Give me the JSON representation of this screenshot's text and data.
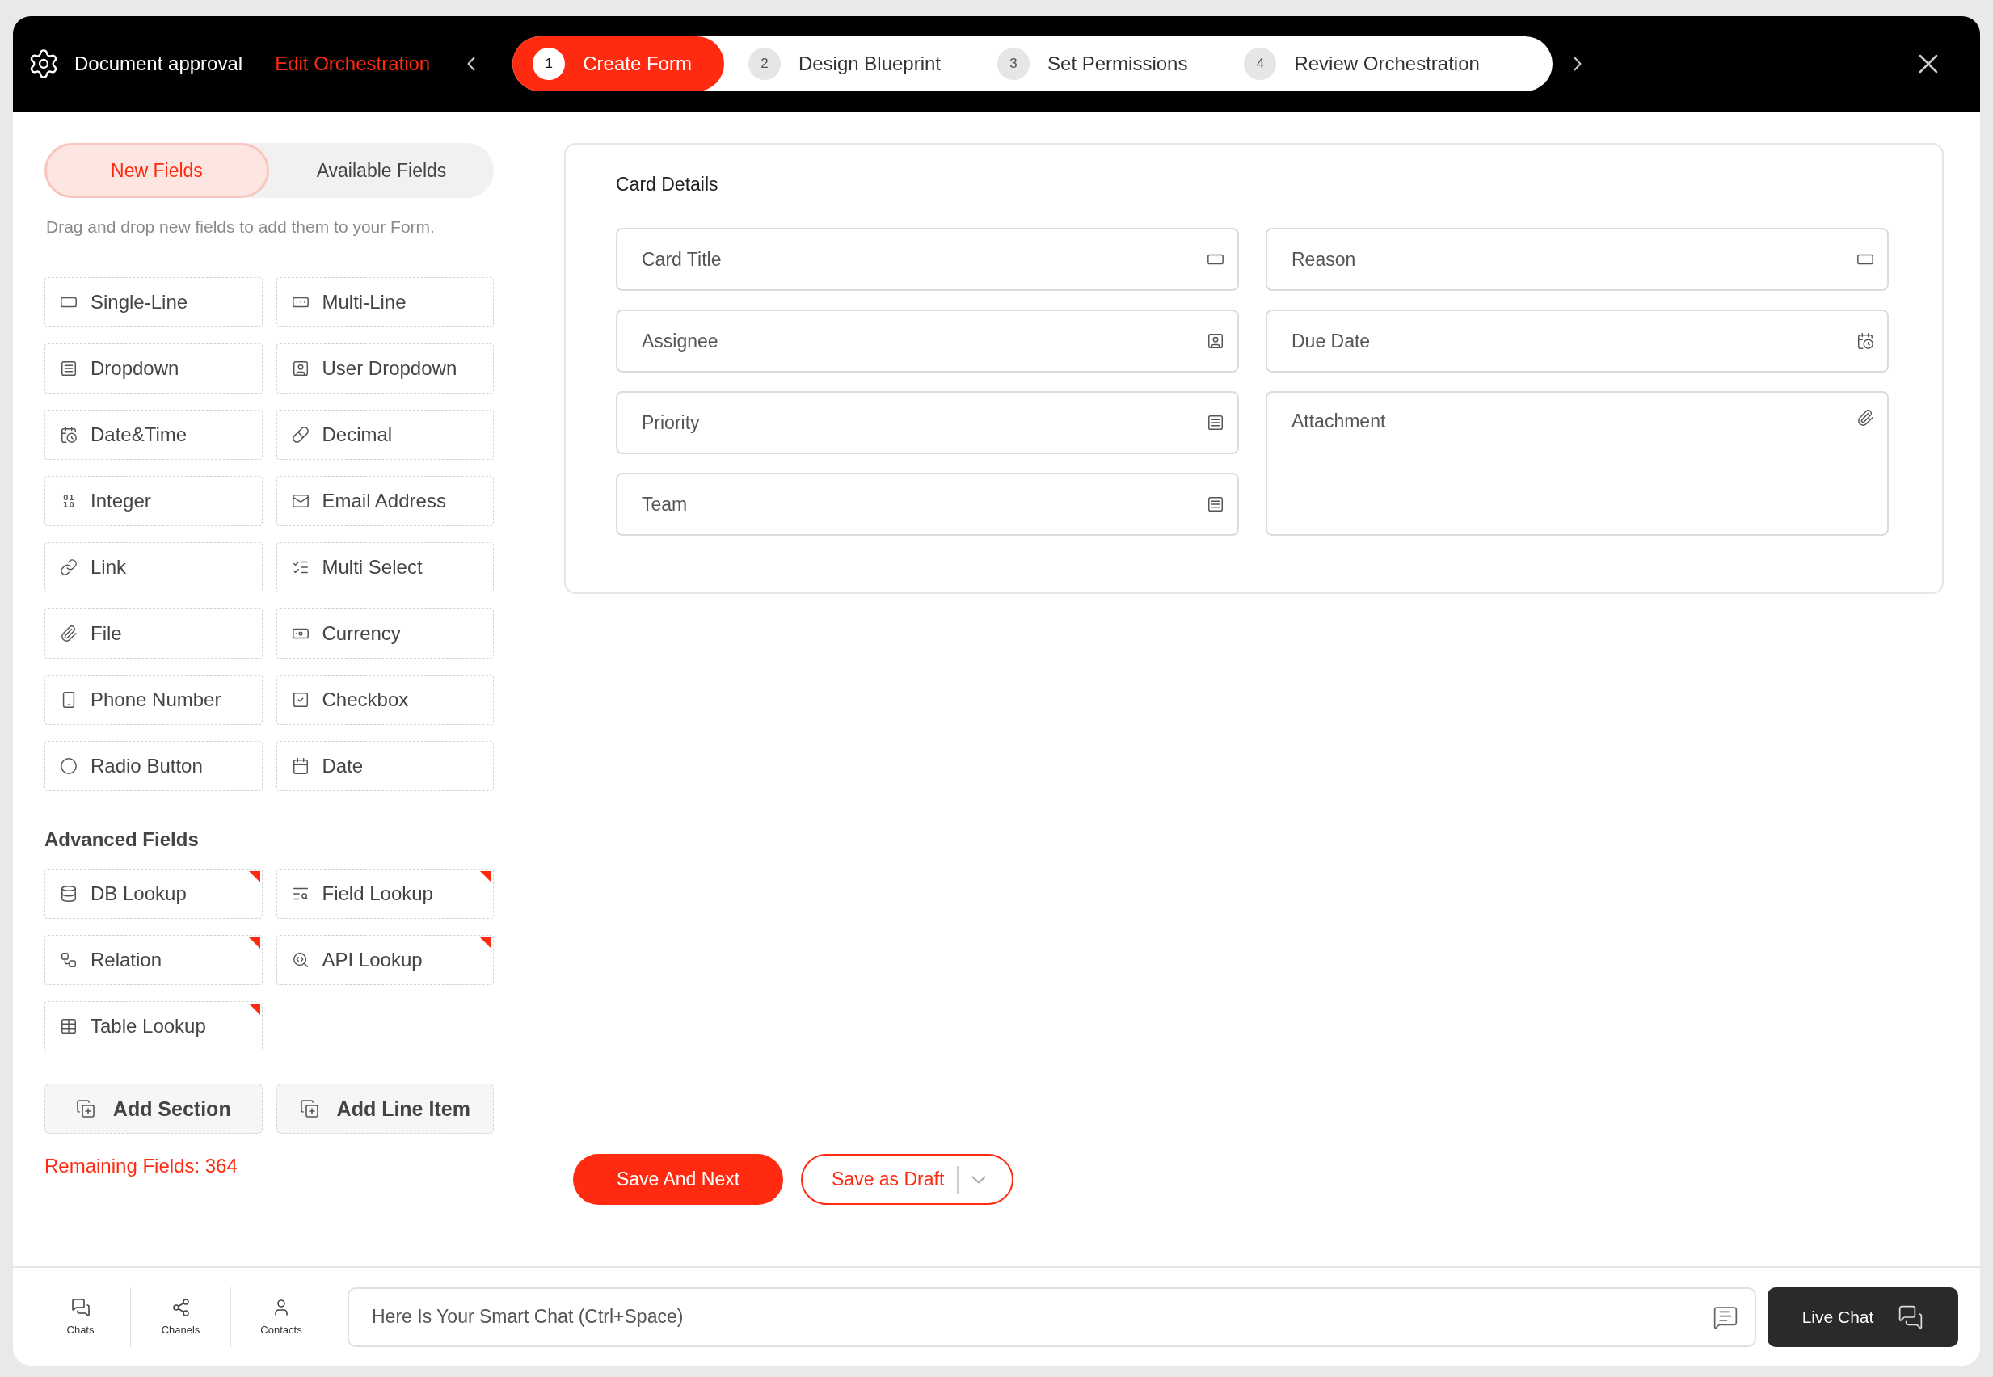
{
  "header": {
    "app_title": "Document approval",
    "mode_link": "Edit Orchestration",
    "steps": [
      {
        "number": "1",
        "label": "Create Form",
        "selected": true
      },
      {
        "number": "2",
        "label": "Design Blueprint",
        "selected": false
      },
      {
        "number": "3",
        "label": "Set Permissions",
        "selected": false
      },
      {
        "number": "4",
        "label": "Review Orchestration",
        "selected": false
      }
    ]
  },
  "left_panel": {
    "tabs": [
      {
        "label": "New Fields",
        "selected": true
      },
      {
        "label": "Available Fields",
        "selected": false
      }
    ],
    "hint": "Drag and drop new fields to add them to your Form.",
    "fields": [
      {
        "label": "Single-Line",
        "kind": "singleline"
      },
      {
        "label": "Multi-Line",
        "kind": "multiline"
      },
      {
        "label": "Dropdown",
        "kind": "dropdown"
      },
      {
        "label": "User Dropdown",
        "kind": "user"
      },
      {
        "label": "Date&Time",
        "kind": "datetime"
      },
      {
        "label": "Decimal",
        "kind": "decimal"
      },
      {
        "label": "Integer",
        "kind": "integer"
      },
      {
        "label": "Email Address",
        "kind": "email"
      },
      {
        "label": "Link",
        "kind": "link"
      },
      {
        "label": "Multi Select",
        "kind": "multiselect"
      },
      {
        "label": "File",
        "kind": "file"
      },
      {
        "label": "Currency",
        "kind": "currency"
      },
      {
        "label": "Phone Number",
        "kind": "phone"
      },
      {
        "label": "Checkbox",
        "kind": "checkbox"
      },
      {
        "label": "Radio Button",
        "kind": "radio"
      },
      {
        "label": "Date",
        "kind": "date"
      }
    ],
    "advanced": {
      "heading": "Advanced Fields",
      "fields": [
        {
          "label": "DB Lookup",
          "kind": "dblookup",
          "flagged": true
        },
        {
          "label": "Field Lookup",
          "kind": "fieldlookup",
          "flagged": true
        },
        {
          "label": "Relation",
          "kind": "relation",
          "flagged": true
        },
        {
          "label": "API Lookup",
          "kind": "apilookup",
          "flagged": true
        },
        {
          "label": "Table Lookup",
          "kind": "tablelookup",
          "flagged": true
        }
      ]
    },
    "actions": [
      "Add Section",
      "Add Line Item"
    ],
    "remaining": "Remaining Fields: 364"
  },
  "card": {
    "title": "Card Details",
    "fields": [
      {
        "placeholder": "Card Title",
        "kind": "singleline"
      },
      {
        "placeholder": "Reason",
        "kind": "singleline"
      },
      {
        "placeholder": "Assignee",
        "kind": "user"
      },
      {
        "placeholder": "Due Date",
        "kind": "datetime"
      },
      {
        "placeholder": "Priority",
        "kind": "dropdown"
      },
      {
        "placeholder": "Attachment",
        "kind": "file"
      },
      {
        "placeholder": "Team",
        "kind": "dropdown"
      }
    ]
  },
  "buttons": {
    "primary": "Save And Next",
    "draft": "Save as Draft"
  },
  "bottom_bar": {
    "nav": [
      {
        "label": "Chats",
        "kind": "chats"
      },
      {
        "label": "Chanels",
        "kind": "channels"
      },
      {
        "label": "Contacts",
        "kind": "contacts"
      }
    ],
    "chat": {
      "placeholder": "Here Is Your Smart Chat (Ctrl+Space)"
    },
    "live_chat": "Live Chat"
  }
}
